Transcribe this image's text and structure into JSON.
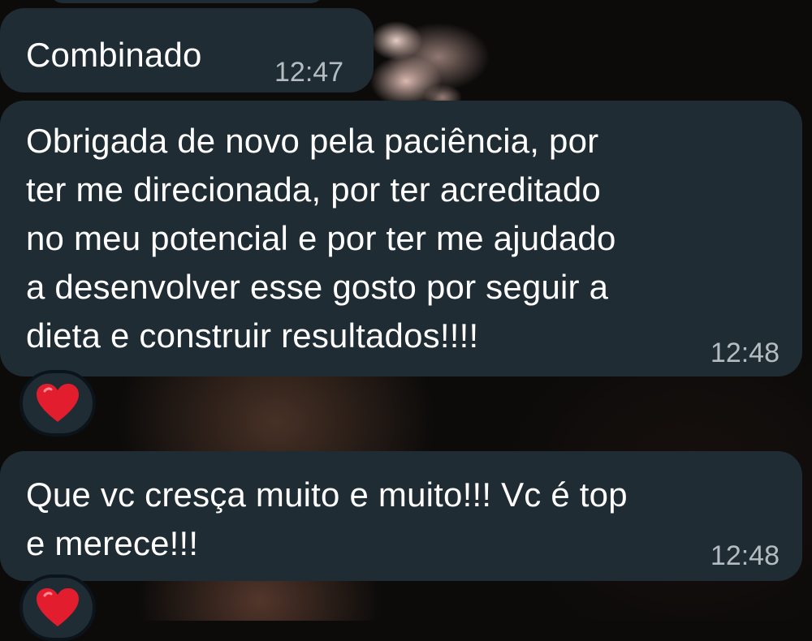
{
  "messages": [
    {
      "text": "Combinado",
      "time": "12:47"
    },
    {
      "text": "Obrigada de novo pela paciência, por\nter me direcionada, por ter acreditado\nno meu potencial e por ter me ajudado\na desenvolver esse gosto por seguir a\ndieta e construir resultados!!!!",
      "time": "12:48",
      "reaction": "heart-icon"
    },
    {
      "text": "Que vc cresça muito e muito!!! Vc é top\ne merece!!!",
      "time": "12:48",
      "reaction": "heart-icon"
    }
  ],
  "colors": {
    "bubble": "#1f2c34",
    "text": "#ffffff",
    "timestamp": "#b4bcc1",
    "heart": "#e11d2e"
  }
}
